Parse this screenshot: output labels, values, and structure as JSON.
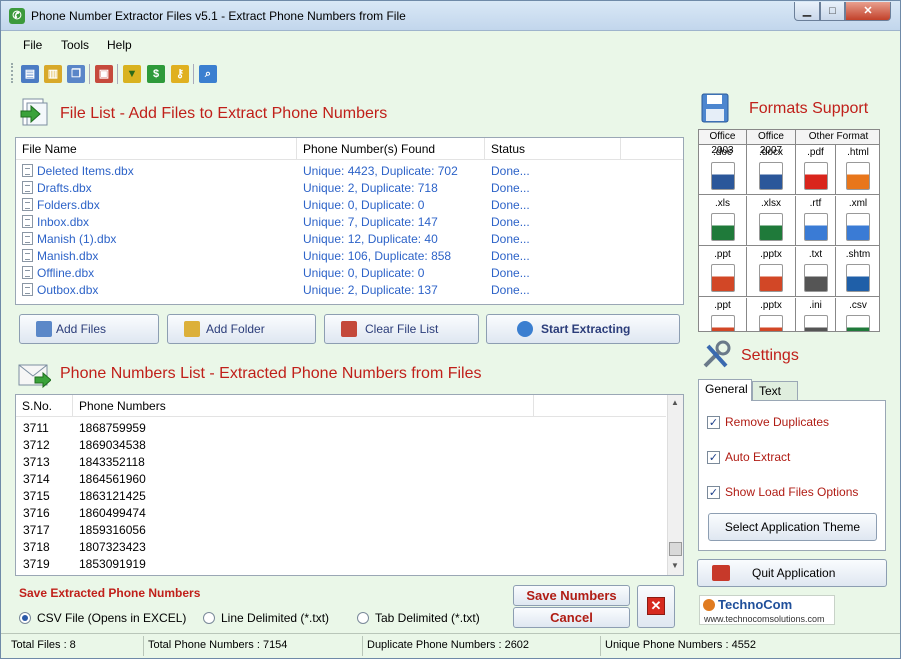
{
  "window": {
    "title": "Phone Number Extractor Files v5.1 - Extract Phone Numbers from File",
    "min": "▁",
    "max": "□",
    "close": "✕"
  },
  "menu": [
    "File",
    "Tools",
    "Help"
  ],
  "file_list": {
    "title": "File List - Add Files to Extract Phone Numbers",
    "columns": [
      "File Name",
      "Phone Number(s) Found",
      "Status"
    ],
    "rows": [
      {
        "name": "Deleted Items.dbx",
        "found": "Unique: 4423, Duplicate: 702",
        "status": "Done..."
      },
      {
        "name": "Drafts.dbx",
        "found": "Unique: 2, Duplicate: 718",
        "status": "Done..."
      },
      {
        "name": "Folders.dbx",
        "found": "Unique: 0, Duplicate: 0",
        "status": "Done..."
      },
      {
        "name": "Inbox.dbx",
        "found": "Unique: 7, Duplicate: 147",
        "status": "Done..."
      },
      {
        "name": "Manish (1).dbx",
        "found": "Unique: 12, Duplicate: 40",
        "status": "Done..."
      },
      {
        "name": "Manish.dbx",
        "found": "Unique: 106, Duplicate: 858",
        "status": "Done..."
      },
      {
        "name": "Offline.dbx",
        "found": "Unique: 0, Duplicate: 0",
        "status": "Done..."
      },
      {
        "name": "Outbox.dbx",
        "found": "Unique: 2, Duplicate: 137",
        "status": "Done..."
      }
    ]
  },
  "buttons": {
    "add_files": "Add Files",
    "add_folder": "Add Folder",
    "clear_file_list": "Clear File List",
    "start_extracting": "Start Extracting"
  },
  "phone_list": {
    "title": "Phone Numbers List - Extracted Phone Numbers from Files",
    "columns": [
      "S.No.",
      "Phone Numbers"
    ],
    "rows": [
      {
        "sno": "3711",
        "number": "1868759959"
      },
      {
        "sno": "3712",
        "number": "1869034538"
      },
      {
        "sno": "3713",
        "number": "1843352118"
      },
      {
        "sno": "3714",
        "number": "1864561960"
      },
      {
        "sno": "3715",
        "number": "1863121425"
      },
      {
        "sno": "3716",
        "number": "1860499474"
      },
      {
        "sno": "3717",
        "number": "1859316056"
      },
      {
        "sno": "3718",
        "number": "1807323423"
      },
      {
        "sno": "3719",
        "number": "1853091919"
      }
    ]
  },
  "formats": {
    "title": "Formats Support",
    "columns": [
      "Office 2003",
      "Office 2007",
      "Other Format"
    ],
    "items": [
      {
        "ext": ".doc",
        "color": "#2b579a"
      },
      {
        "ext": ".docx",
        "color": "#2b579a"
      },
      {
        "ext": ".pdf",
        "color": "#d9251c"
      },
      {
        "ext": ".html",
        "color": "#e8761b"
      },
      {
        "ext": ".xls",
        "color": "#1f7a3a"
      },
      {
        "ext": ".xlsx",
        "color": "#1f7a3a"
      },
      {
        "ext": ".rtf",
        "color": "#3a7bd5"
      },
      {
        "ext": ".xml",
        "color": "#3a7bd5"
      },
      {
        "ext": ".ppt",
        "color": "#d24726"
      },
      {
        "ext": ".pptx",
        "color": "#d24726"
      },
      {
        "ext": ".txt",
        "color": "#555555"
      },
      {
        "ext": ".shtm",
        "color": "#1f5fa8"
      },
      {
        "ext": ".ppt",
        "color": "#d24726"
      },
      {
        "ext": ".pptx",
        "color": "#d24726"
      },
      {
        "ext": ".ini",
        "color": "#555555"
      },
      {
        "ext": ".csv",
        "color": "#1f7a3a"
      }
    ]
  },
  "settings": {
    "title": "Settings",
    "tabs": [
      "General",
      "Text"
    ],
    "options": [
      {
        "label": "Remove Duplicates",
        "checked": true
      },
      {
        "label": "Auto Extract",
        "checked": true
      },
      {
        "label": "Show Load Files Options",
        "checked": true
      }
    ],
    "theme_button": "Select Application Theme"
  },
  "quit_button": "Quit Application",
  "save": {
    "title": "Save Extracted Phone Numbers",
    "options": [
      {
        "label": "CSV File (Opens in EXCEL)",
        "selected": true
      },
      {
        "label": "Line Delimited (*.txt)",
        "selected": false
      },
      {
        "label": "Tab Delimited (*.txt)",
        "selected": false
      }
    ],
    "save_button": "Save Numbers",
    "cancel_button": "Cancel"
  },
  "logo": {
    "name": "TechnoCom",
    "url": "www.technocomsolutions.com"
  },
  "status_bar": {
    "total_files": "Total Files :  8",
    "total_phone": "Total Phone Numbers :   7154",
    "duplicate_phone": "Duplicate Phone Numbers :    2602",
    "unique_phone": "Unique Phone Numbers :    4552"
  },
  "colors": {
    "accent_red": "#c0201a",
    "link_blue": "#2d63c8",
    "background": "#eaf7e8"
  }
}
